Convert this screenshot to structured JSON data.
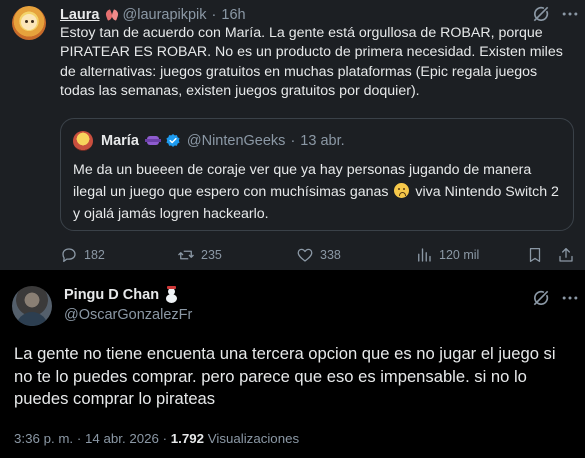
{
  "quoting_post": {
    "author": {
      "name": "Laura",
      "handle": "@laurapikpik",
      "time": "16h"
    },
    "text": "Estoy tan de acuerdo con María. La gente está orgullosa de ROBAR, porque PIRATEAR ES ROBAR. No es un producto de primera necesidad. Existen miles de alternativas: juegos gratuitos en muchas plataformas (Epic regala juegos todas las semanas, existen juegos gratuitos por doquier).",
    "quoted": {
      "author": {
        "name": "María",
        "handle": "@NintenGeeks",
        "time": "13 abr."
      },
      "text_part1": "Me da un bueeen de coraje ver que ya hay personas jugando de manera ilegal un juego que espero con muchísimas ganas",
      "text_part2": "viva Nintendo Switch 2 y ojalá jamás logren hackearlo."
    },
    "actions": {
      "replies": "182",
      "reposts": "235",
      "likes": "338",
      "views": "120 mil"
    }
  },
  "main_post": {
    "author": {
      "name": "Pingu D Chan",
      "handle": "@OscarGonzalezFr"
    },
    "text": "La gente no tiene encuenta una tercera opcion que es no jugar el juego si no te lo puedes comprar. pero parece que eso es impensable. si no lo puedes comprar lo pirateas",
    "time": "3:36 p. m.",
    "date": "14 abr. 2026",
    "views_count": "1.792",
    "views_label": "Visualizaciones"
  },
  "colors": {
    "background": "#000000",
    "highlight_background": "#1c1f23",
    "muted_text": "#8b98a5",
    "verified_blue": "#1d9bf0"
  },
  "icons": [
    "grok-icon",
    "more-icon",
    "verified-icon",
    "reply-icon",
    "repost-icon",
    "like-icon",
    "views-icon",
    "bookmark-icon",
    "share-icon"
  ]
}
